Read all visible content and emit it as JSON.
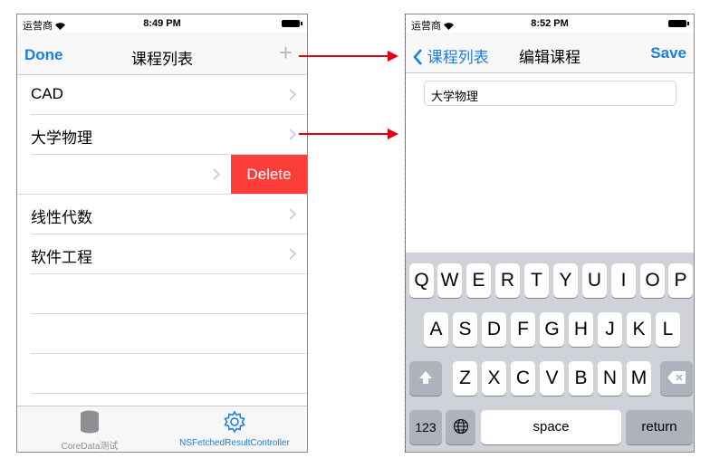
{
  "left_screen": {
    "status": {
      "carrier": "运营商",
      "time": "8:49 PM"
    },
    "nav": {
      "done": "Done",
      "title": "课程列表",
      "add": "+"
    },
    "rows": [
      {
        "label": "CAD"
      },
      {
        "label": "大学物理"
      },
      {
        "label": "",
        "delete": "Delete"
      },
      {
        "label": "线性代数"
      },
      {
        "label": "软件工程"
      }
    ],
    "tabs": [
      {
        "label": "CoreData测试",
        "icon": "database-icon"
      },
      {
        "label": "NSFetchedResultController",
        "icon": "gear-icon"
      }
    ]
  },
  "right_screen": {
    "status": {
      "carrier": "运营商",
      "time": "8:52 PM"
    },
    "nav": {
      "back": "课程列表",
      "title": "编辑课程",
      "save": "Save"
    },
    "field_value": "大学物理",
    "keyboard": {
      "row1": [
        "Q",
        "W",
        "E",
        "R",
        "T",
        "Y",
        "U",
        "I",
        "O",
        "P"
      ],
      "row2": [
        "A",
        "S",
        "D",
        "F",
        "G",
        "H",
        "J",
        "K",
        "L"
      ],
      "row3": [
        "Z",
        "X",
        "C",
        "V",
        "B",
        "N",
        "M"
      ],
      "numbers": "123",
      "space": "space",
      "return": "return"
    }
  },
  "colors": {
    "accent": "#1a7ee4",
    "delete": "#fc3d39",
    "arrow": "#e0000e"
  }
}
